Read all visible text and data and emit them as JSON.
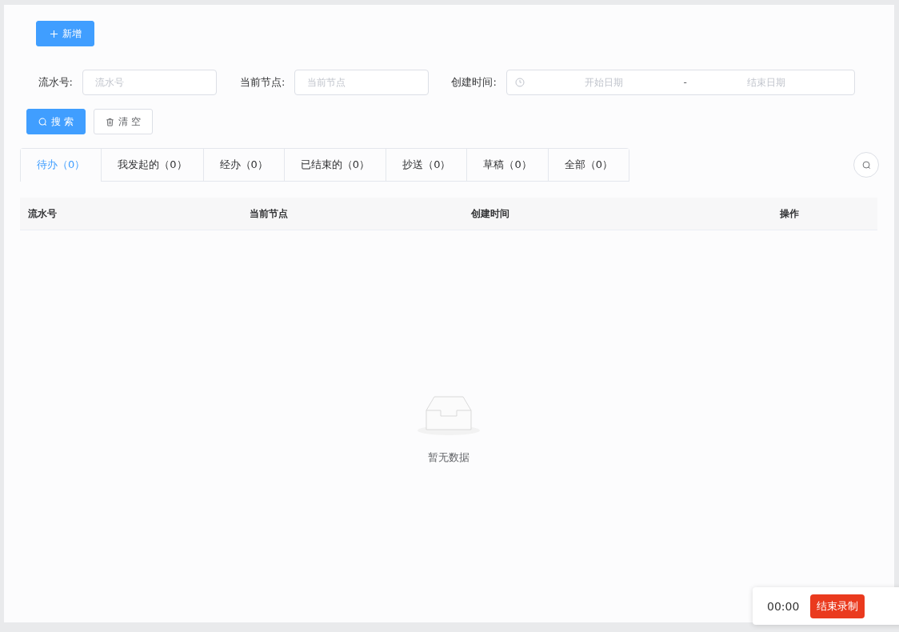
{
  "toolbar": {
    "add_button": "新增"
  },
  "filters": [
    {
      "kind": "text",
      "label": "流水号:",
      "placeholder": "流水号"
    },
    {
      "kind": "text",
      "label": "当前节点:",
      "placeholder": "当前节点"
    },
    {
      "kind": "daterange",
      "label": "创建时间:",
      "start_placeholder": "开始日期",
      "separator": "-",
      "end_placeholder": "结束日期"
    }
  ],
  "actions": {
    "search": "搜 索",
    "clear": "清 空"
  },
  "tabs": [
    {
      "label": "待办（0）",
      "selected": true
    },
    {
      "label": "我发起的（0）",
      "selected": false
    },
    {
      "label": "经办（0）",
      "selected": false
    },
    {
      "label": "已结束的（0）",
      "selected": false
    },
    {
      "label": "抄送（0）",
      "selected": false
    },
    {
      "label": "草稿（0）",
      "selected": false
    },
    {
      "label": "全部（0）",
      "selected": false
    }
  ],
  "table": {
    "columns": [
      "流水号",
      "当前节点",
      "创建时间",
      "操作"
    ],
    "empty_text": "暂无数据"
  },
  "recorder": {
    "time": "00:00",
    "stop_button": "结束录制"
  }
}
